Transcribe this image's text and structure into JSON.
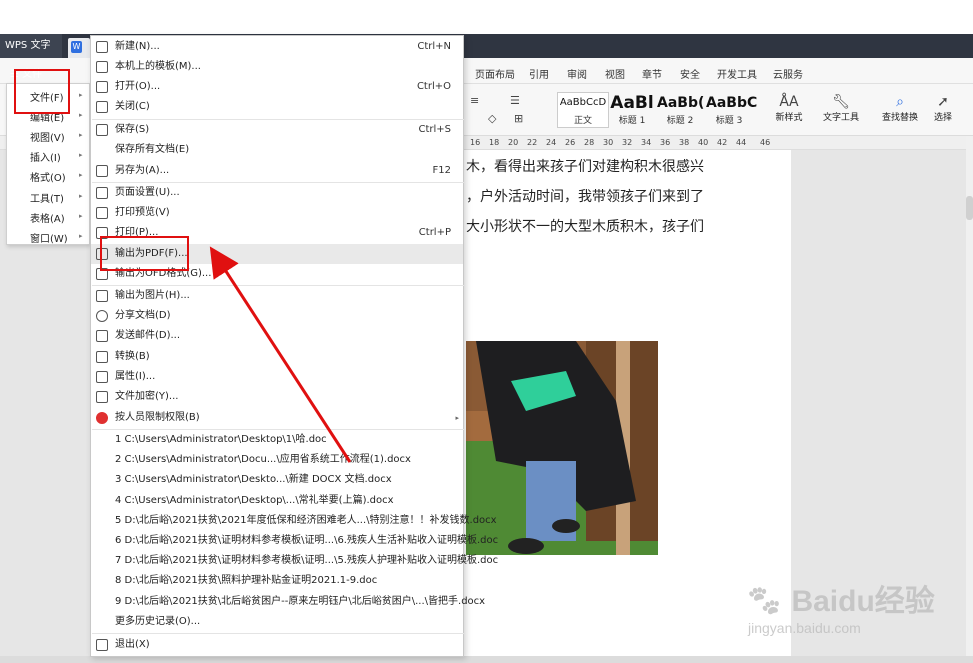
{
  "app": {
    "name": "WPS 文字"
  },
  "ribbon_tabs": [
    "页面布局",
    "引用",
    "审阅",
    "视图",
    "章节",
    "安全",
    "开发工具",
    "云服务"
  ],
  "ribbon": {
    "styles": [
      {
        "preview": "AaBbCcD",
        "name": "正文"
      },
      {
        "preview": "AaBl",
        "name": "标题 1"
      },
      {
        "preview": "AaBb(",
        "name": "标题 2"
      },
      {
        "preview": "AaBbC",
        "name": "标题 3"
      }
    ],
    "new_style": "新样式",
    "text_tools": "文字工具",
    "find_replace": "查找替换",
    "select": "选择"
  },
  "ruler_numbers": [
    "16",
    "18",
    "20",
    "22",
    "24",
    "26",
    "28",
    "30",
    "32",
    "34",
    "36",
    "38",
    "40",
    "42",
    "44",
    "46"
  ],
  "left_menu": {
    "top_label": "文件",
    "items": [
      "文件(F)",
      "编辑(E)",
      "视图(V)",
      "插入(I)",
      "格式(O)",
      "工具(T)",
      "表格(A)",
      "窗口(W)"
    ]
  },
  "file_menu": {
    "items": [
      {
        "label": "新建(N)...",
        "shortcut": "Ctrl+N"
      },
      {
        "label": "本机上的模板(M)...",
        "shortcut": ""
      },
      {
        "label": "打开(O)...",
        "shortcut": "Ctrl+O"
      },
      {
        "label": "关闭(C)",
        "shortcut": ""
      },
      {
        "label": "保存(S)",
        "shortcut": "Ctrl+S"
      },
      {
        "label": "保存所有文档(E)",
        "shortcut": ""
      },
      {
        "label": "另存为(A)...",
        "shortcut": "F12"
      },
      {
        "label": "页面设置(U)...",
        "shortcut": ""
      },
      {
        "label": "打印预览(V)",
        "shortcut": ""
      },
      {
        "label": "打印(P)...",
        "shortcut": "Ctrl+P"
      },
      {
        "label": "输出为PDF(F)...",
        "shortcut": ""
      },
      {
        "label": "输出为OFD格式(G)...",
        "shortcut": ""
      },
      {
        "label": "输出为图片(H)...",
        "shortcut": ""
      },
      {
        "label": "分享文档(D)",
        "shortcut": ""
      },
      {
        "label": "发送邮件(D)...",
        "shortcut": ""
      },
      {
        "label": "转换(B)",
        "shortcut": ""
      },
      {
        "label": "属性(I)...",
        "shortcut": ""
      },
      {
        "label": "文件加密(Y)...",
        "shortcut": ""
      },
      {
        "label": "按人员限制权限(B)",
        "shortcut": ""
      }
    ],
    "recent": [
      "1 C:\\Users\\Administrator\\Desktop\\1\\哈.doc",
      "2 C:\\Users\\Administrator\\Docu...\\应用省系统工作流程(1).docx",
      "3 C:\\Users\\Administrator\\Deskto...\\新建 DOCX 文档.docx",
      "4 C:\\Users\\Administrator\\Desktop\\...\\常礼举要(上篇).docx",
      "5 D:\\北后峪\\2021扶贫\\2021年度低保和经济困难老人...\\特别注意！！补发钱数.docx",
      "6 D:\\北后峪\\2021扶贫\\证明材料参考模板\\证明...\\6.残疾人生活补贴收入证明模板.doc",
      "7 D:\\北后峪\\2021扶贫\\证明材料参考模板\\证明...\\5.残疾人护理补贴收入证明模板.doc",
      "8 D:\\北后峪\\2021扶贫\\照料护理补贴金证明2021.1-9.doc",
      "9 D:\\北后峪\\2021扶贫\\北后峪贫困户--原来左明钰户\\北后峪贫困户\\...\\皆把手.docx"
    ],
    "more_history": "更多历史记录(O)...",
    "exit": "退出(X)"
  },
  "document": {
    "lines": [
      "木，看得出来孩子们对建构积木很感兴",
      "，户外活动时间，我带领孩子们来到了",
      "大小形状不一的大型木质积木，孩子们"
    ]
  },
  "watermark": {
    "logo": "Baidu经验",
    "url": "jingyan.baidu.com"
  },
  "colors": {
    "highlight": "#e01010",
    "titlebar": "#2f3541"
  }
}
